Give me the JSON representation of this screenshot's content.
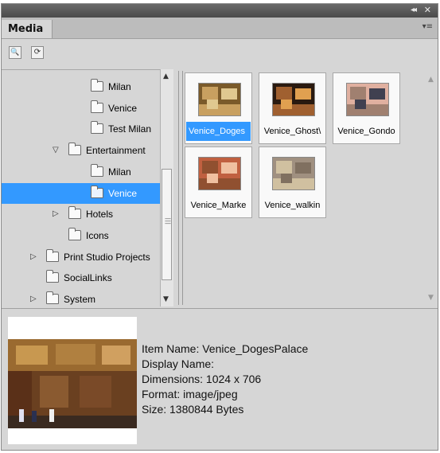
{
  "panel": {
    "tab_label": "Media",
    "collapse_glyph": "◂◂",
    "close_glyph": "✕",
    "menu_glyph": "▾≡"
  },
  "toolbar": {
    "buttons": [
      {
        "icon": "search-icon",
        "glyph": "🔍"
      },
      {
        "icon": "refresh-icon",
        "glyph": "⟳"
      }
    ]
  },
  "tree": {
    "items": [
      {
        "label": "Milan",
        "level": 3,
        "expander": "none",
        "selected": false
      },
      {
        "label": "Venice",
        "level": 3,
        "expander": "none",
        "selected": false
      },
      {
        "label": "Test Milan",
        "level": 3,
        "expander": "none",
        "selected": false
      },
      {
        "label": "Entertainment",
        "level": 2,
        "expander": "expanded",
        "selected": false
      },
      {
        "label": "Milan",
        "level": 3,
        "expander": "none",
        "selected": false
      },
      {
        "label": "Venice",
        "level": 3,
        "expander": "none",
        "selected": true
      },
      {
        "label": "Hotels",
        "level": 2,
        "expander": "collapsed",
        "selected": false
      },
      {
        "label": "Icons",
        "level": 2,
        "expander": "none",
        "selected": false
      },
      {
        "label": "Print Studio Projects",
        "level": 1,
        "expander": "collapsed",
        "selected": false
      },
      {
        "label": "SocialLinks",
        "level": 1,
        "expander": "none",
        "selected": false
      },
      {
        "label": "System",
        "level": 1,
        "expander": "collapsed",
        "selected": false
      }
    ]
  },
  "thumbnails": [
    {
      "caption": "Venice_Doges",
      "selected": true,
      "colors": [
        "#7a5a2a",
        "#c8a060",
        "#e0c890"
      ]
    },
    {
      "caption": "Venice_Ghost\\",
      "selected": false,
      "colors": [
        "#2a1a10",
        "#a06030",
        "#e0a050"
      ]
    },
    {
      "caption": "Venice_Gondo",
      "selected": false,
      "colors": [
        "#e0b0a0",
        "#a08070",
        "#404050"
      ]
    },
    {
      "caption": "Venice_Marke",
      "selected": false,
      "colors": [
        "#c06040",
        "#905030",
        "#f0c0a0"
      ]
    },
    {
      "caption": "Venice_walkin",
      "selected": false,
      "colors": [
        "#a09080",
        "#d0c0a0",
        "#807060"
      ]
    }
  ],
  "details": {
    "item_name": "Item Name: Venice_DogesPalace",
    "display_name": "Display Name:",
    "dimensions": "Dimensions: 1024 x 706",
    "format": "Format: image/jpeg",
    "size": "Size: 1380844 Bytes"
  },
  "colors": {
    "selection": "#3399ff",
    "panel_bg": "#d6d6d6",
    "titlebar": "#555555"
  }
}
